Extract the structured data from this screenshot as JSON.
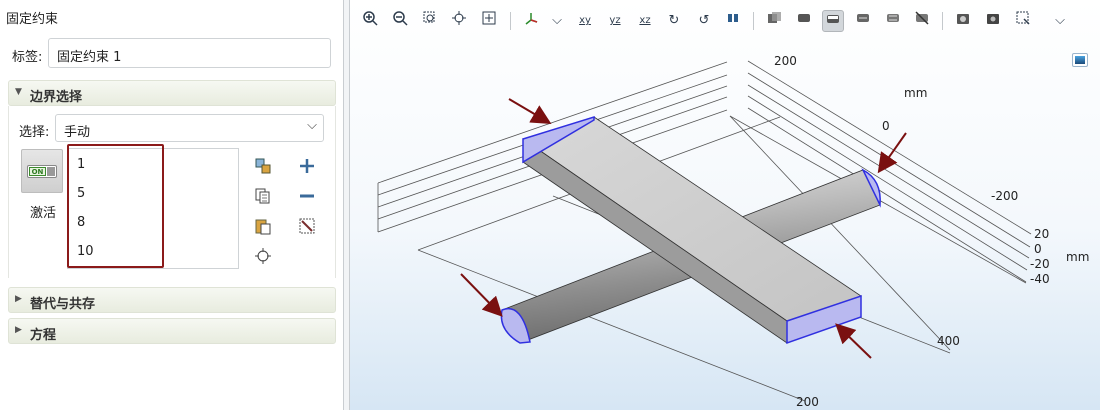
{
  "panel": {
    "title": "固定约束",
    "label_caption": "标签:",
    "label_value": "固定约束 1"
  },
  "boundary_section": {
    "title": "边界选择",
    "select_caption": "选择:",
    "select_value": "手动",
    "toggle_on_text": "ON",
    "toggle_label": "激活",
    "selected_boundaries": [
      "1",
      "5",
      "8",
      "10"
    ]
  },
  "sections": {
    "override": "替代与共存",
    "equation": "方程"
  },
  "toolbar": {
    "xy_label": "xy",
    "yz_label": "yz",
    "xz_label": "xz"
  },
  "axes": {
    "z_tick_200": "200",
    "z_unit": "mm",
    "z_tick_0": "0",
    "x_tick_neg200": "-200",
    "y_tick_20": "20",
    "y_tick_0": "0",
    "y_tick_neg20": "-20",
    "y_tick_neg40": "-40",
    "y_unit": "mm",
    "x_tick_400": "400",
    "x_tick_200": "200"
  },
  "colors": {
    "selection_blue": "#3030e0",
    "arrow_red": "#7a1010",
    "highlight_red": "#8b1a1a"
  }
}
